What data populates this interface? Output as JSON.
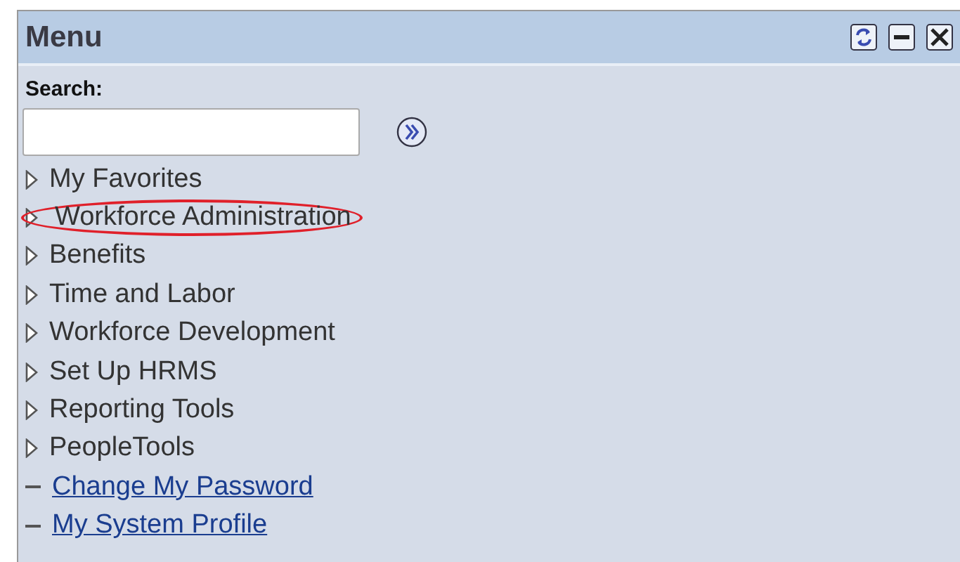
{
  "panel": {
    "title": "Menu"
  },
  "search": {
    "label": "Search:"
  },
  "items": [
    {
      "label": "My Favorites",
      "kind": "folder",
      "highlighted": false
    },
    {
      "label": "Workforce Administration",
      "kind": "folder",
      "highlighted": true
    },
    {
      "label": "Benefits",
      "kind": "folder",
      "highlighted": false
    },
    {
      "label": "Time and Labor",
      "kind": "folder",
      "highlighted": false
    },
    {
      "label": "Workforce Development",
      "kind": "folder",
      "highlighted": false
    },
    {
      "label": "Set Up HRMS",
      "kind": "folder",
      "highlighted": false
    },
    {
      "label": "Reporting Tools",
      "kind": "folder",
      "highlighted": false
    },
    {
      "label": "PeopleTools",
      "kind": "folder",
      "highlighted": false
    },
    {
      "label": "Change My Password",
      "kind": "link",
      "highlighted": false
    },
    {
      "label": "My System Profile",
      "kind": "link",
      "highlighted": false
    }
  ]
}
